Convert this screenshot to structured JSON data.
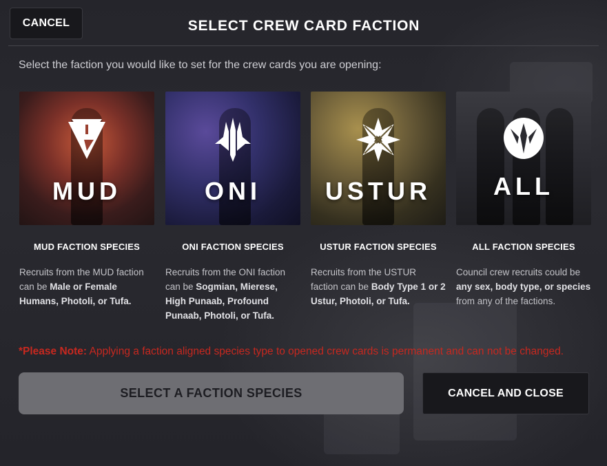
{
  "header": {
    "cancel_label": "CANCEL",
    "title": "SELECT CREW CARD FACTION"
  },
  "subtitle": "Select the faction you would like to set for the crew cards you are opening:",
  "cards": [
    {
      "word": "MUD",
      "icon": "mud-triangle-emblem",
      "heading": "MUD FACTION SPECIES",
      "desc_plain": "Recruits from the MUD faction can be ",
      "desc_bold": "Male or Female Humans, Photoli, or Tufa.",
      "colors": [
        "#5a2a2a",
        "#b04a35",
        "#2a1818"
      ]
    },
    {
      "word": "ONI",
      "icon": "oni-trident-emblem",
      "heading": "ONI FACTION SPECIES",
      "desc_plain": "Recruits from the ONI faction can be ",
      "desc_bold": "Sogmian, Mierese, High Punaab, Profound Punaab, Photoli, or Tufa.",
      "colors": [
        "#26244a",
        "#4a3a7a",
        "#151530"
      ]
    },
    {
      "word": "USTUR",
      "icon": "ustur-star-emblem",
      "heading": "USTUR FACTION SPECIES",
      "desc_plain": "Recruits from the USTUR faction can be ",
      "desc_bold": "Body Type 1 or 2 Ustur, Photoli, or Tufa.",
      "colors": [
        "#3a3526",
        "#8a7a45",
        "#25221a"
      ]
    },
    {
      "word": "ALL",
      "icon": "council-shield-emblem",
      "heading": "ALL FACTION SPECIES",
      "desc_plain": "Council crew recruits could be ",
      "desc_bold": "any sex, body type, or species",
      "desc_after": " from any of the factions.",
      "colors": [
        "#2e2e34",
        "#55555c",
        "#202024"
      ]
    }
  ],
  "note": {
    "prefix": "*Please Note:",
    "text": " Applying a faction aligned species type to opened crew cards is permanent and can not be changed."
  },
  "footer": {
    "select_label": "SELECT A FACTION SPECIES",
    "close_label": "CANCEL AND CLOSE"
  }
}
